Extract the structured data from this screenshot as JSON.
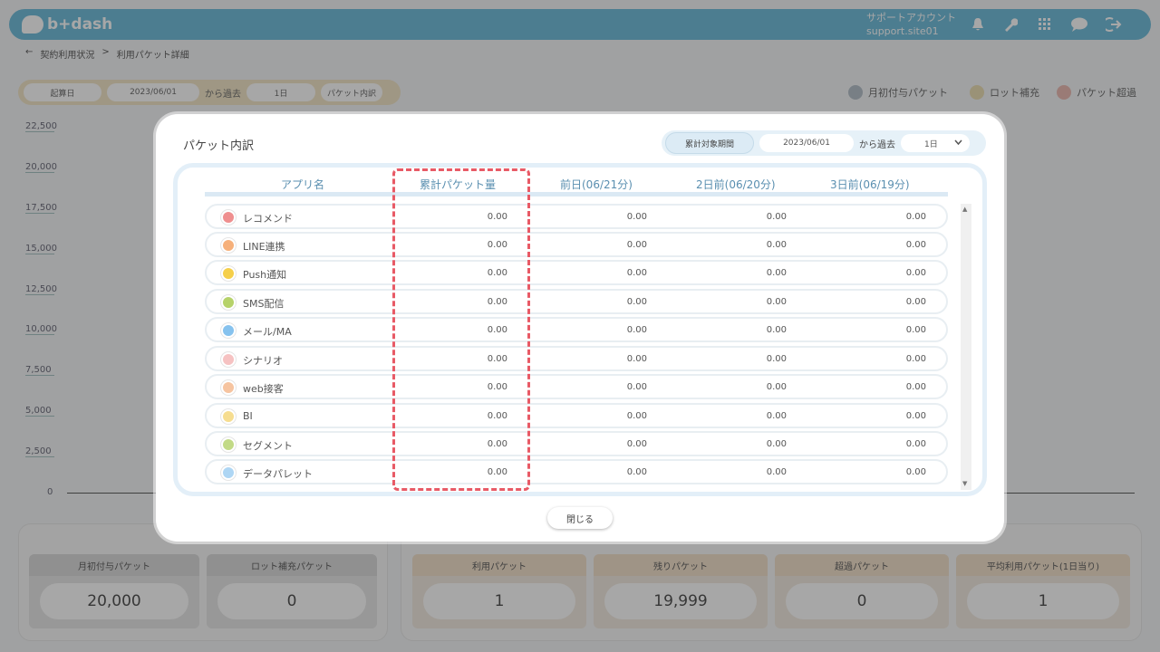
{
  "header": {
    "logo_text": "b+dash",
    "account_name": "サポートアカウント",
    "account_id": "support.site01",
    "icons": [
      "bell-icon",
      "wrench-icon",
      "grid-icon",
      "chat-icon",
      "logout-icon"
    ]
  },
  "breadcrumb": {
    "back": "←",
    "parent": "契約利用状況",
    "separator": ">",
    "current": "利用パケット詳細"
  },
  "background_controls": {
    "start_label": "起算日",
    "start_date": "2023/06/01",
    "from_past": "から過去",
    "range": "1日",
    "breakdown_button": "パケット内訳"
  },
  "legend": [
    {
      "label": "月初付与パケット",
      "color": "#aab7c2"
    },
    {
      "label": "ロット補充",
      "color": "#e8d9a8"
    },
    {
      "label": "パケット超過",
      "color": "#e8b0a6"
    }
  ],
  "y_ticks": [
    "22,500",
    "20,000",
    "17,500",
    "15,000",
    "12,500",
    "10,000",
    "7,500",
    "5,000",
    "2,500",
    "0"
  ],
  "stats_left": [
    {
      "label": "月初付与パケット",
      "value": "20,000"
    },
    {
      "label": "ロット補充パケット",
      "value": "0"
    }
  ],
  "stats_right": [
    {
      "label": "利用パケット",
      "value": "1"
    },
    {
      "label": "残りパケット",
      "value": "19,999"
    },
    {
      "label": "超過パケット",
      "value": "0"
    },
    {
      "label": "平均利用パケット(1日当り)",
      "value": "1"
    }
  ],
  "modal": {
    "title": "パケット内訳",
    "period_label": "累計対象期間",
    "period_date": "2023/06/01",
    "from_past": "から過去",
    "range": "1日",
    "columns": [
      "アプリ名",
      "累計パケット量",
      "前日(06/21分)",
      "2日前(06/20分)",
      "3日前(06/19分)"
    ],
    "rows": [
      {
        "name": "レコメンド",
        "color": "#ef8f8f",
        "values": [
          "0.00",
          "0.00",
          "0.00",
          "0.00"
        ]
      },
      {
        "name": "LINE連携",
        "color": "#f6b07a",
        "values": [
          "0.00",
          "0.00",
          "0.00",
          "0.00"
        ]
      },
      {
        "name": "Push通知",
        "color": "#f5cf4a",
        "values": [
          "0.00",
          "0.00",
          "0.00",
          "0.00"
        ]
      },
      {
        "name": "SMS配信",
        "color": "#b6d26a",
        "values": [
          "0.00",
          "0.00",
          "0.00",
          "0.00"
        ]
      },
      {
        "name": "メール/MA",
        "color": "#86c2ee",
        "values": [
          "0.00",
          "0.00",
          "0.00",
          "0.00"
        ]
      },
      {
        "name": "シナリオ",
        "color": "#f6c2c2",
        "values": [
          "0.00",
          "0.00",
          "0.00",
          "0.00"
        ]
      },
      {
        "name": "web接客",
        "color": "#f6c4a0",
        "values": [
          "0.00",
          "0.00",
          "0.00",
          "0.00"
        ]
      },
      {
        "name": "BI",
        "color": "#f6dd90",
        "values": [
          "0.00",
          "0.00",
          "0.00",
          "0.00"
        ]
      },
      {
        "name": "セグメント",
        "color": "#c2da86",
        "values": [
          "0.00",
          "0.00",
          "0.00",
          "0.00"
        ]
      },
      {
        "name": "データパレット",
        "color": "#aed6f4",
        "values": [
          "0.00",
          "0.00",
          "0.00",
          "0.00"
        ]
      }
    ],
    "close_button": "閉じる"
  }
}
